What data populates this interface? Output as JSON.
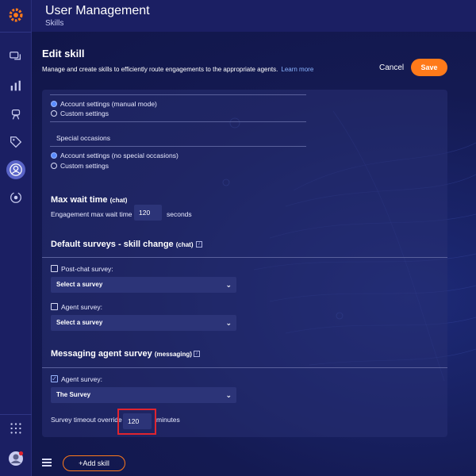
{
  "header": {
    "title": "User Management",
    "subtitle": "Skills"
  },
  "edit": {
    "title": "Edit skill",
    "description": "Manage and create skills to efficiently route engagements to the appropriate agents.",
    "learn_more": "Learn more",
    "cancel_label": "Cancel",
    "save_label": "Save"
  },
  "account_settings": {
    "options": [
      "Account settings (manual mode)",
      "Custom settings"
    ],
    "selected": "Account settings (manual mode)"
  },
  "special_occasions": {
    "heading": "Special occasions",
    "options": [
      "Account settings (no special occasions)",
      "Custom settings"
    ],
    "selected": "Account settings (no special occasions)"
  },
  "max_wait": {
    "heading": "Max wait time",
    "heading_tag": "(chat)",
    "field_label": "Engagement max wait time",
    "value": "120",
    "unit": "seconds"
  },
  "default_surveys": {
    "heading": "Default surveys - skill change",
    "heading_tag": "(chat)",
    "post_chat_label": "Post-chat survey:",
    "post_chat_checked": false,
    "post_chat_select": "Select a survey",
    "agent_label": "Agent survey:",
    "agent_checked": false,
    "agent_select": "Select a survey"
  },
  "messaging_survey": {
    "heading": "Messaging agent survey",
    "heading_tag": "(messaging)",
    "agent_label": "Agent survey:",
    "agent_checked": true,
    "agent_select": "The Survey",
    "timeout_label": "Survey timeout override",
    "timeout_value": "120",
    "timeout_unit": "minutes"
  },
  "footer": {
    "add_skill_label": "+Add skill"
  },
  "colors": {
    "accent": "#ff7a1a",
    "background": "#141a52",
    "highlight": "#e0242f"
  }
}
